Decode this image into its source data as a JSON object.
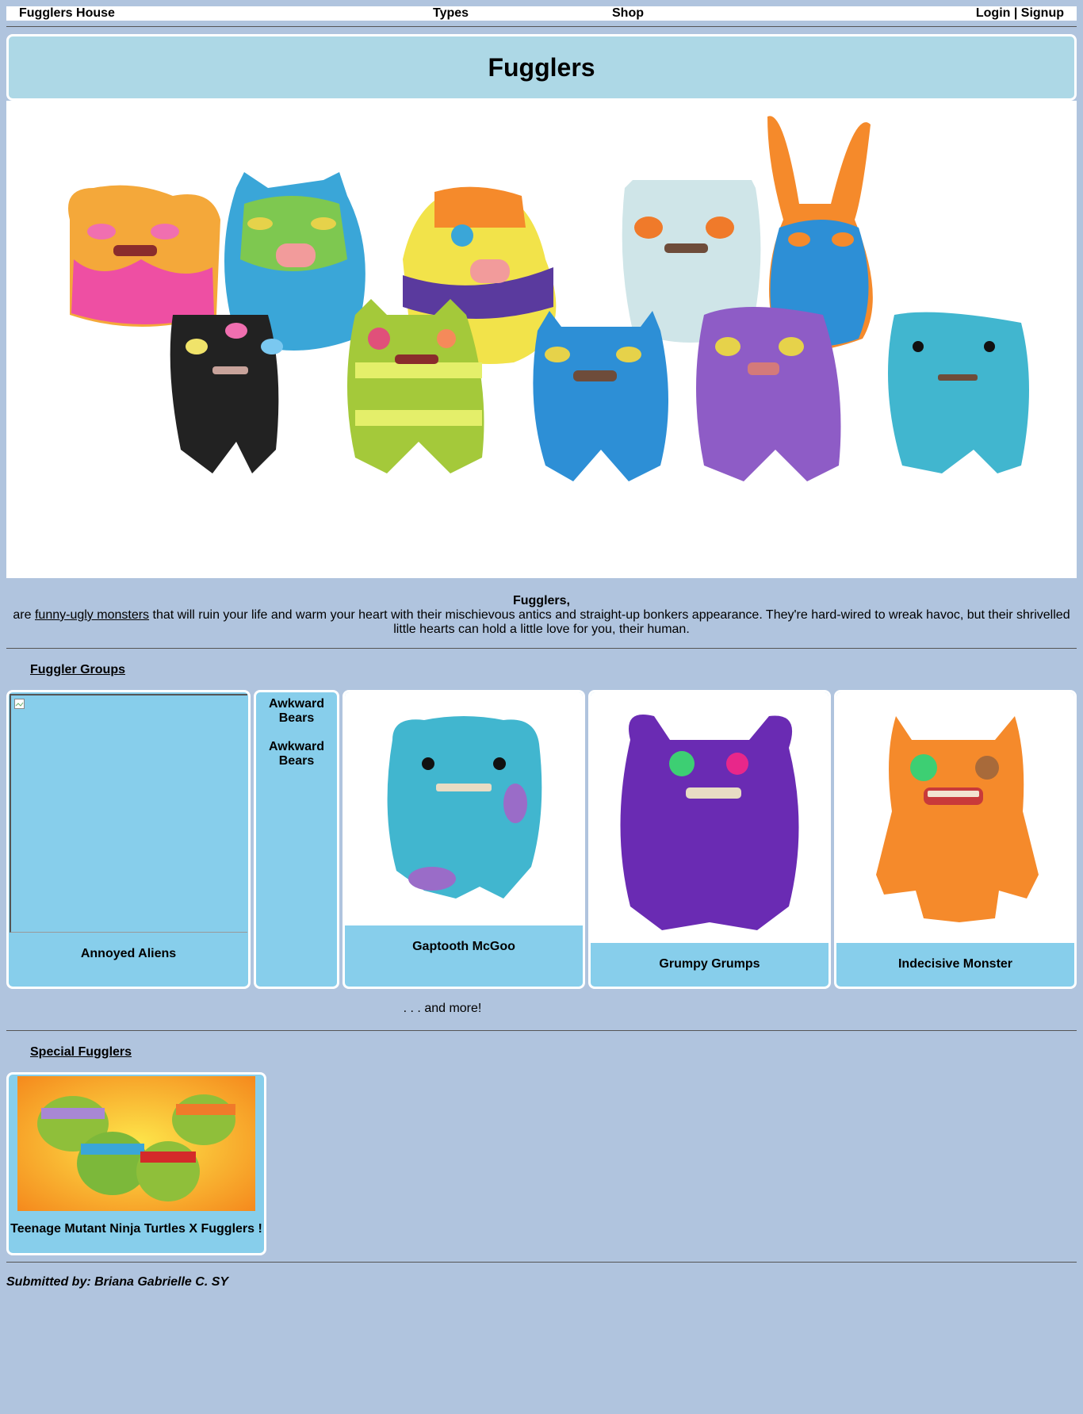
{
  "nav": {
    "brand": "Fugglers House",
    "types": "Types",
    "shop": "Shop",
    "auth": "Login | Signup"
  },
  "header": {
    "title": "Fugglers"
  },
  "intro": {
    "lead": "Fugglers,",
    "before_link": "are ",
    "link": "funny-ugly monsters",
    "after_link": " that will ruin your life and warm your heart with their mischievous antics and straight-up bonkers appearance. They're hard-wired to wreak havoc, but their shrivelled little hearts can hold a little love for you, their human."
  },
  "groups": {
    "title": "Fuggler Groups",
    "cards": [
      {
        "caption": "Annoyed Aliens"
      },
      {
        "caption": "Awkward Bears",
        "caption2": "Awkward Bears"
      },
      {
        "caption": "Gaptooth McGoo"
      },
      {
        "caption": "Grumpy Grumps"
      },
      {
        "caption": "Indecisive Monster"
      }
    ],
    "more": ". . . and more!"
  },
  "special": {
    "title": "Special Fugglers",
    "caption": "Teenage Mutant Ninja Turtles X Fugglers !"
  },
  "footer": {
    "submitted": "Submitted by: Briana Gabrielle C. SY"
  },
  "colors": {
    "page_bg": "#b0c4de",
    "title_bg": "#add8e6",
    "card_bg": "#87ceeb"
  }
}
